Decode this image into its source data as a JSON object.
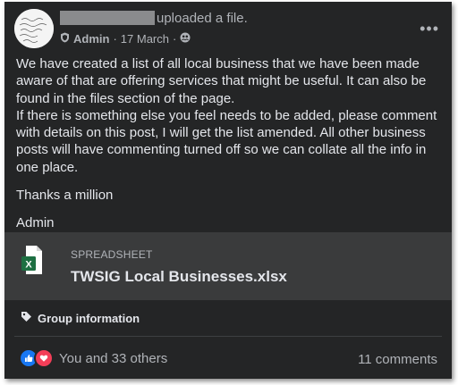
{
  "post": {
    "uploaded_text": "uploaded a file.",
    "role": "Admin",
    "sep1": "·",
    "date": "17 March",
    "sep2": "·",
    "more": "•••",
    "body": {
      "p1": "We have created a list of all local business that we have been made aware of that are offering services that might be useful. It can also be found in the files section of the page.",
      "p2": "If there is something else you feel needs to be added, please comment with details on this post, I will get the list amended. All other business posts will have commenting turned off so we can collate all the info in one place.",
      "p3": "Thanks a million",
      "p4": "Admin"
    }
  },
  "attachment": {
    "type_label": "SPREADSHEET",
    "file_name": "TWSIG Local Businesses.xlsx",
    "icon_letter": "X",
    "icon": "excel-file-icon"
  },
  "group_info": {
    "label": "Group information",
    "icon": "tag-icon"
  },
  "footer": {
    "reactions_text": "You and 33 others",
    "comments_text": "11 comments",
    "reaction_icons": [
      "like-icon",
      "love-icon"
    ]
  },
  "colors": {
    "card_bg": "#242526",
    "attachment_bg": "#3a3b3c",
    "text_primary": "#e4e6eb",
    "text_secondary": "#b0b3b8",
    "like_blue": "#1877f2",
    "love_red": "#f33e58",
    "excel_green": "#1d6f42"
  }
}
